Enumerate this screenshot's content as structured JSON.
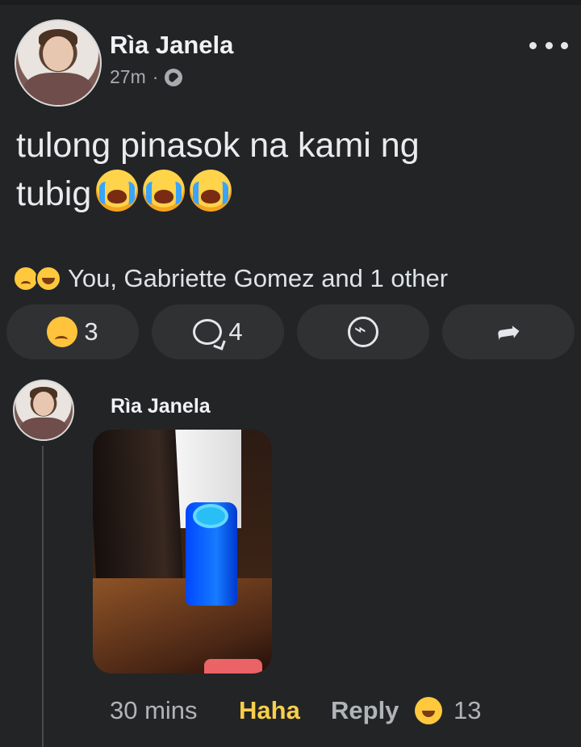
{
  "post": {
    "author": "Rìa Janela",
    "time": "27m",
    "separator": "·",
    "text_line_1": "tulong pinasok na kami ng",
    "text_line_2": "tubig"
  },
  "reactions": {
    "summary": "You, Gabriette Gomez and 1 other",
    "count": "3",
    "comments_count": "4"
  },
  "comment": {
    "author": "Rìa Janela",
    "time": "30 mins",
    "reaction_label": "Haha",
    "reply_label": "Reply",
    "reaction_count": "13"
  },
  "icons": {
    "globe": "globe-icon",
    "more": "more-options-icon",
    "crying": "crying-face-icon",
    "comment": "comment-icon",
    "messenger": "messenger-icon",
    "share": "share-icon"
  },
  "colors": {
    "background": "#232426",
    "button_background": "#303133",
    "haha": "#f7cf4b"
  }
}
